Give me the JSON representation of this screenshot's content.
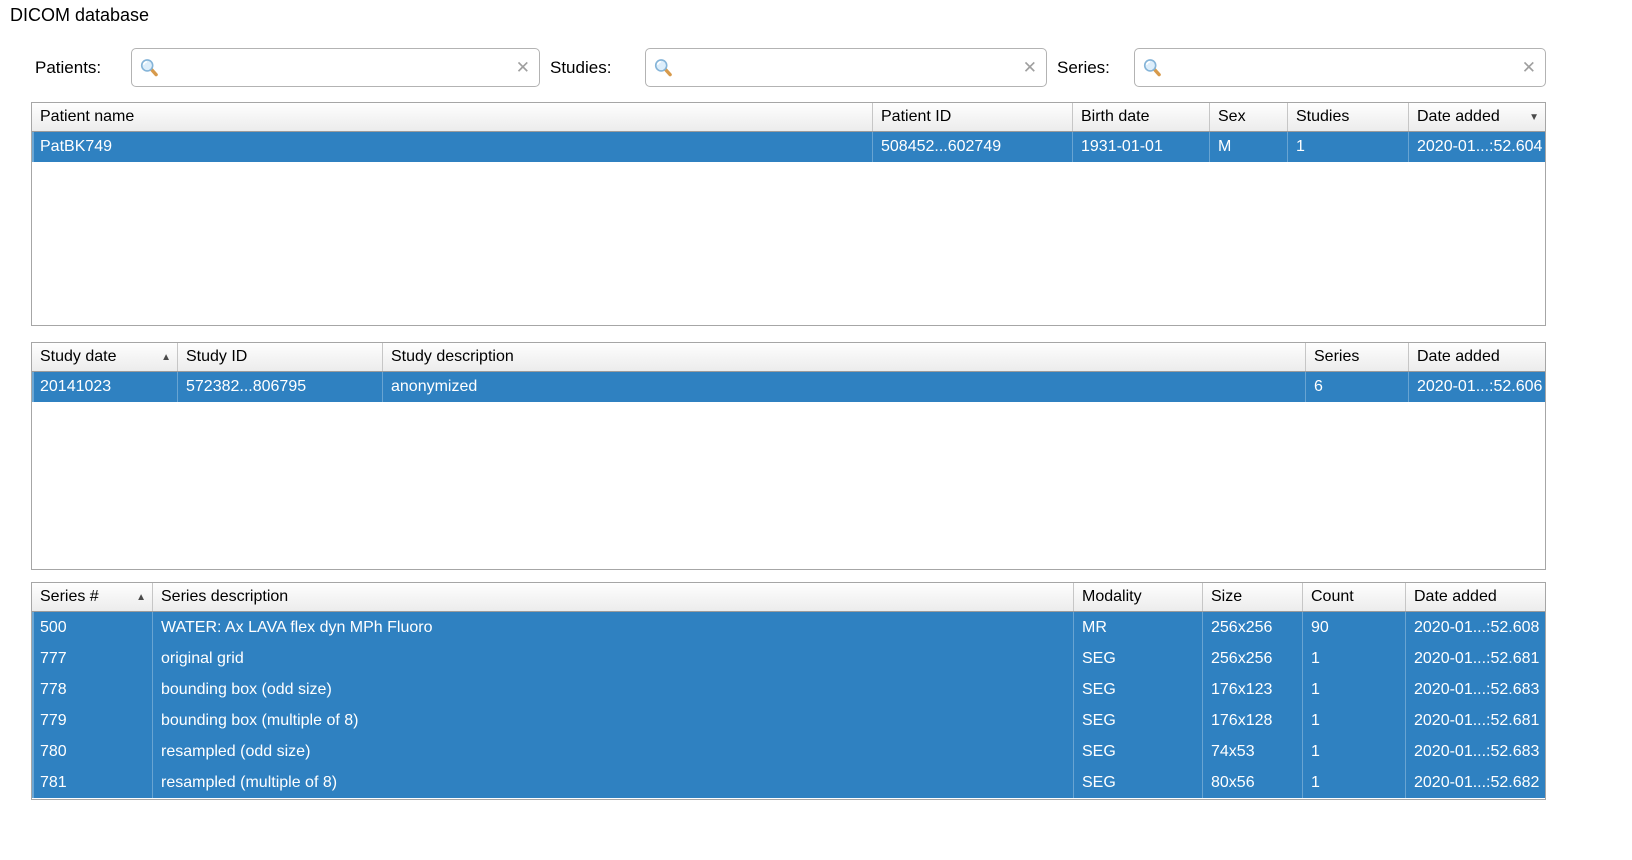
{
  "title": "DICOM database",
  "filters": {
    "patients": {
      "label": "Patients:",
      "value": "",
      "placeholder": ""
    },
    "studies": {
      "label": "Studies:",
      "value": "",
      "placeholder": ""
    },
    "series": {
      "label": "Series:",
      "value": "",
      "placeholder": ""
    }
  },
  "icons": {
    "search": "magnifier",
    "clear": "✕",
    "sort_asc": "▲",
    "sort_desc": "▼"
  },
  "colors": {
    "selection_blue": "#2f81c1",
    "table_border": "#a6a6a6",
    "header_gradient_bottom": "#ececec",
    "magnifier_glass": "#ddeefb",
    "magnifier_handle": "#d79a4b"
  },
  "patients_table": {
    "columns": [
      {
        "label": "Patient name"
      },
      {
        "label": "Patient ID"
      },
      {
        "label": "Birth date"
      },
      {
        "label": "Sex"
      },
      {
        "label": "Studies"
      },
      {
        "label": "Date added",
        "sort": "desc"
      }
    ],
    "rows": [
      [
        "PatBK749",
        "508452...602749",
        "1931-01-01",
        "M",
        "1",
        "2020-01...:52.604"
      ]
    ],
    "selected_rows": [
      0
    ]
  },
  "studies_table": {
    "columns": [
      {
        "label": "Study date",
        "sort": "asc"
      },
      {
        "label": "Study ID"
      },
      {
        "label": "Study description"
      },
      {
        "label": "Series"
      },
      {
        "label": "Date added"
      }
    ],
    "rows": [
      [
        "20141023",
        "572382...806795",
        "anonymized",
        "6",
        "2020-01...:52.606"
      ]
    ],
    "selected_rows": [
      0
    ]
  },
  "series_table": {
    "columns": [
      {
        "label": "Series #",
        "sort": "asc"
      },
      {
        "label": "Series description"
      },
      {
        "label": "Modality"
      },
      {
        "label": "Size"
      },
      {
        "label": "Count"
      },
      {
        "label": "Date added"
      }
    ],
    "rows": [
      [
        "500",
        "WATER: Ax LAVA flex dyn MPh Fluoro",
        "MR",
        "256x256",
        "90",
        "2020-01...:52.608"
      ],
      [
        "777",
        "original grid",
        "SEG",
        "256x256",
        "1",
        "2020-01...:52.681"
      ],
      [
        "778",
        "bounding box (odd size)",
        "SEG",
        "176x123",
        "1",
        "2020-01...:52.683"
      ],
      [
        "779",
        "bounding box (multiple of 8)",
        "SEG",
        "176x128",
        "1",
        "2020-01...:52.681"
      ],
      [
        "780",
        "resampled (odd size)",
        "SEG",
        "74x53",
        "1",
        "2020-01...:52.683"
      ],
      [
        "781",
        "resampled (multiple of 8)",
        "SEG",
        "80x56",
        "1",
        "2020-01...:52.682"
      ]
    ],
    "selected_rows": [
      0,
      1,
      2,
      3,
      4,
      5
    ]
  }
}
